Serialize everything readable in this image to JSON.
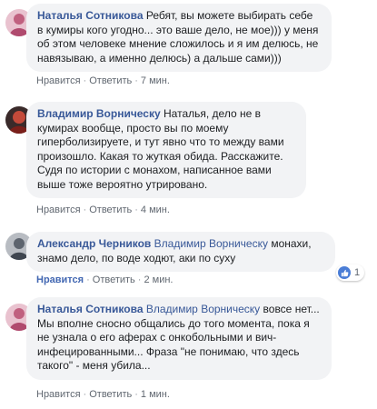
{
  "comments": [
    {
      "author": "Наталья Сотникова",
      "mention": "",
      "text": "Ребят, вы можете выбирать себе в кумиры кого угодно... это ваше дело, не мое))) у меня об этом человеке мнение сложилось и я им делюсь, не навязываю, а именно делюсь) а дальше сами)))",
      "like_label": "Нравится",
      "reply_label": "Ответить",
      "time": "7 мин.",
      "avatar": "user-avatar-pink"
    },
    {
      "author": "Владимир Ворническу",
      "mention": "",
      "text": "Наталья, дело не в кумирах вообще, просто вы по моему гиперболизируете, и тут явно что то между вами произошло. Какая то жуткая обида. Расскажите. Судя по истории с монахом, написанное вами выше тоже вероятно утрировано.",
      "like_label": "Нравится",
      "reply_label": "Ответить",
      "time": "4 мин.",
      "avatar": "user-avatar-red"
    },
    {
      "author": "Александр Черников",
      "mention": "Владимир Ворническу",
      "text": "монахи, знамо дело, по воде ходют, аки по суху",
      "like_label": "Нравится",
      "reply_label": "Ответить",
      "time": "2 мин.",
      "liked": true,
      "reaction_count": "1",
      "avatar": "user-avatar-gray"
    },
    {
      "author": "Наталья Сотникова",
      "mention": "Владимир Ворническу",
      "text": "вовсе нет... Мы вполне сносно общались до того момента, пока я не узнала о его аферах с онкобольными и вич-инфецированными... Фраза \"не понимаю, что здесь такого\" - меня убила...",
      "like_label": "Нравится",
      "reply_label": "Ответить",
      "time": "1 мин.",
      "avatar": "user-avatar-pink"
    }
  ],
  "colors": {
    "link": "#385898",
    "bubble": "#f2f3f5",
    "like_active": "#4267b2"
  }
}
